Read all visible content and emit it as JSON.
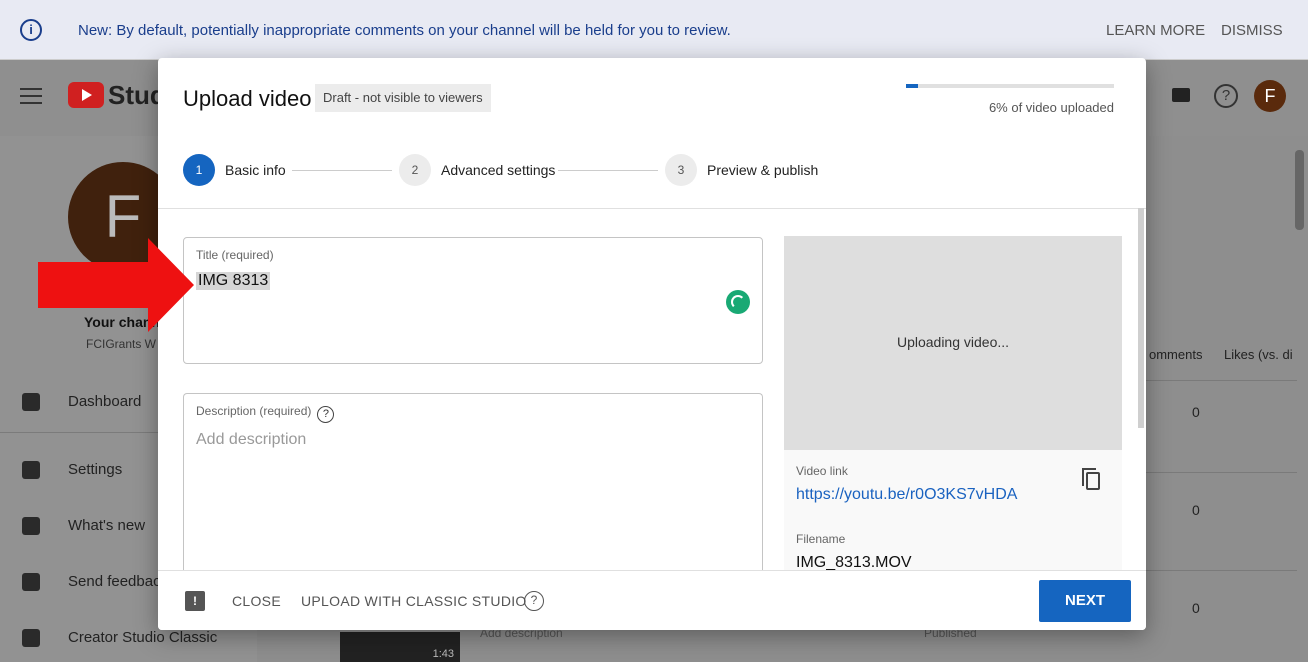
{
  "banner": {
    "info_icon": "info-icon",
    "message": "New: By default, potentially inappropriate comments on your channel will be held for you to review.",
    "learn_more": "LEARN MORE",
    "dismiss": "DISMISS"
  },
  "header": {
    "logo_text": "Studi",
    "avatar_letter": "F"
  },
  "channel": {
    "avatar_letter": "F",
    "title": "Your channe",
    "subtitle": "FCIGrants W"
  },
  "sidebar": {
    "items": [
      {
        "label": "Dashboard",
        "icon": "dashboard-icon"
      },
      {
        "label": "Settings",
        "icon": "gear-icon"
      },
      {
        "label": "What's new",
        "icon": "alert-icon"
      },
      {
        "label": "Send feedback",
        "icon": "feedback-icon"
      },
      {
        "label": "Creator Studio Classic",
        "icon": "classic-icon"
      }
    ]
  },
  "table": {
    "col_comments": "omments",
    "col_likes": "Likes (vs. di",
    "values": [
      "0",
      "0",
      "0"
    ],
    "thumb_duration": "1:43",
    "row_desc": "Add description",
    "row_status": "Published"
  },
  "modal": {
    "title": "Upload video",
    "draft_badge": "Draft - not visible to viewers",
    "progress_percent": 6,
    "progress_label": "6% of video uploaded",
    "steps": [
      {
        "num": "1",
        "label": "Basic info"
      },
      {
        "num": "2",
        "label": "Advanced settings"
      },
      {
        "num": "3",
        "label": "Preview & publish"
      }
    ],
    "title_field": {
      "label": "Title (required)",
      "value": "IMG 8313"
    },
    "description_field": {
      "label": "Description (required)",
      "placeholder": "Add description"
    },
    "preview": {
      "status": "Uploading video..."
    },
    "video_link": {
      "label": "Video link",
      "url": "https://youtu.be/r0O3KS7vHDA"
    },
    "filename": {
      "label": "Filename",
      "value": "IMG_8313.MOV"
    },
    "footer": {
      "close": "CLOSE",
      "classic": "UPLOAD WITH CLASSIC STUDIO",
      "next": "NEXT"
    }
  },
  "colors": {
    "accent": "#1565c0",
    "arrow": "#ee1111",
    "spinner": "#19a974"
  }
}
